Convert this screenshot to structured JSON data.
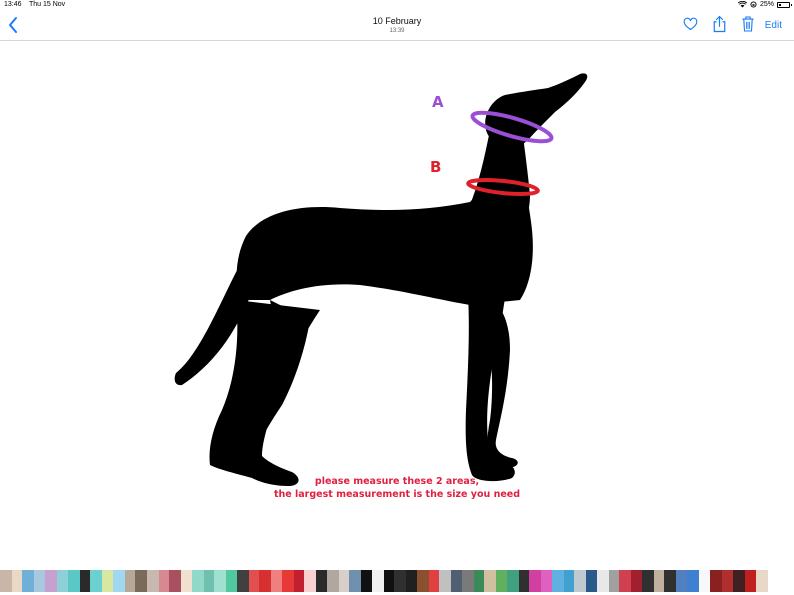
{
  "status_bar": {
    "time": "13:46",
    "date": "Thu 15 Nov",
    "battery": "25%",
    "battery_level": 0.25
  },
  "nav": {
    "title": "10 February",
    "subtitle": "13:39",
    "edit_label": "Edit"
  },
  "photo": {
    "label_a": "A",
    "label_b": "B",
    "caption_line1": "please measure these 2 areas,",
    "caption_line2": "the largest measurement is the size you need",
    "color_a": "#9a4fd6",
    "color_b": "#e0202a"
  },
  "filmstrip": {
    "colors": [
      "#c9b6a8",
      "#e8d8c4",
      "#6fb0d8",
      "#a8c8e0",
      "#c8a0d0",
      "#8fd0d8",
      "#5bc8c8",
      "#2a2a2a",
      "#6ad0d0",
      "#d8e8a0",
      "#9fd8f0",
      "#b8a898",
      "#7a6a5a",
      "#c8b8b0",
      "#d88890",
      "#a85060",
      "#f0e0d0",
      "#90d8c8",
      "#70c0b0",
      "#a0e0d0",
      "#50c8a0",
      "#404040",
      "#e05050",
      "#d83030",
      "#f08080",
      "#e83838",
      "#c02030",
      "#f8d0d0",
      "#2a2a2a",
      "#b0a8a0",
      "#d8d0c8",
      "#7090b0",
      "#111111",
      "#f0f0f0",
      "#101010",
      "#303030",
      "#202020",
      "#8a5030",
      "#e04040",
      "#c0c0c0",
      "#506070",
      "#7a7a7a",
      "#3a8a5a",
      "#d0c0a0",
      "#60b060",
      "#40a080",
      "#303030",
      "#d040a0",
      "#e060c0",
      "#60b0e0",
      "#40a0d0",
      "#c0c8d0",
      "#2a5a8a",
      "#e8e8e8",
      "#a0a0a0",
      "#d04050",
      "#a02030",
      "#303030",
      "#c0b0a0",
      "#303030",
      "#5080c0",
      "#4080d0",
      "#f8f8f8",
      "#8a2020",
      "#b03030",
      "#402020",
      "#c02020",
      "#e8d8c8"
    ],
    "widths": [
      12,
      10,
      12,
      11,
      12,
      11,
      12,
      10,
      12,
      11,
      12,
      10,
      12,
      12,
      10,
      12,
      11,
      12,
      10,
      12,
      11,
      12,
      10,
      12,
      11,
      12,
      10,
      12,
      11,
      12,
      10,
      12,
      11,
      12,
      10,
      12,
      11,
      12,
      10,
      12,
      11,
      12,
      10,
      12,
      11,
      12,
      10,
      12,
      11,
      12,
      10,
      12,
      11,
      12,
      10,
      12,
      11,
      12,
      10,
      12,
      11,
      12,
      11,
      12,
      11,
      12,
      11,
      12
    ]
  }
}
